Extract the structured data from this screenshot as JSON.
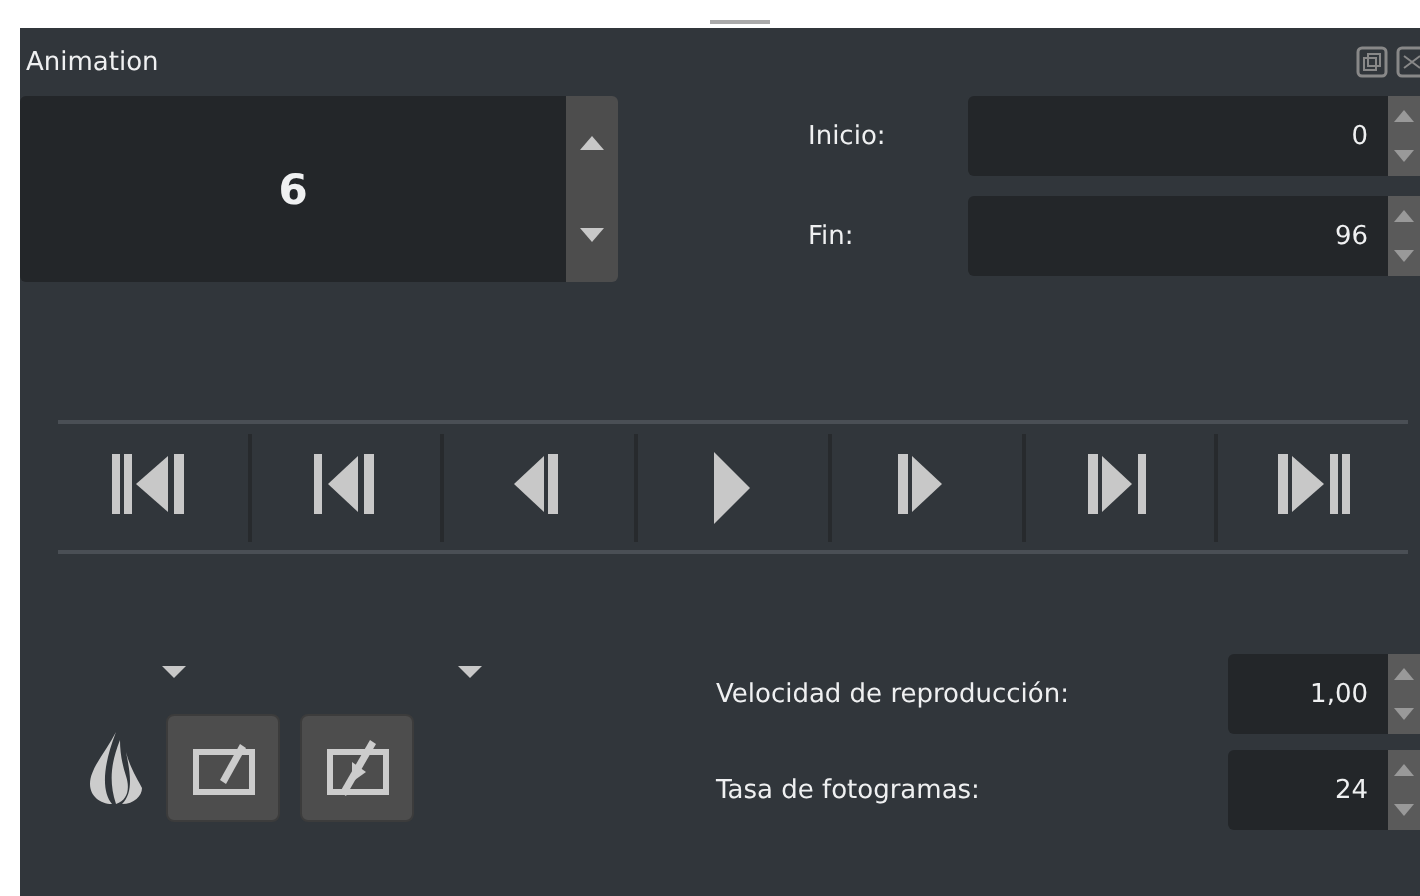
{
  "panel": {
    "title": "Animation"
  },
  "current_frame": {
    "value": "6"
  },
  "range": [
    {
      "label": "Inicio:",
      "value": "0"
    },
    {
      "label": "Fin:",
      "value": "96"
    }
  ],
  "transport": [
    {
      "kind": "first"
    },
    {
      "kind": "prev-key"
    },
    {
      "kind": "prev"
    },
    {
      "kind": "play"
    },
    {
      "kind": "next"
    },
    {
      "kind": "next-key"
    },
    {
      "kind": "last"
    }
  ],
  "playback": [
    {
      "label": "Velocidad de reproducción:",
      "value": "1,00"
    },
    {
      "label": "Tasa de fotogramas:",
      "value": "24"
    }
  ],
  "tools": [
    {
      "kind": "onion"
    },
    {
      "kind": "draw-frame"
    },
    {
      "kind": "play-frame"
    }
  ]
}
